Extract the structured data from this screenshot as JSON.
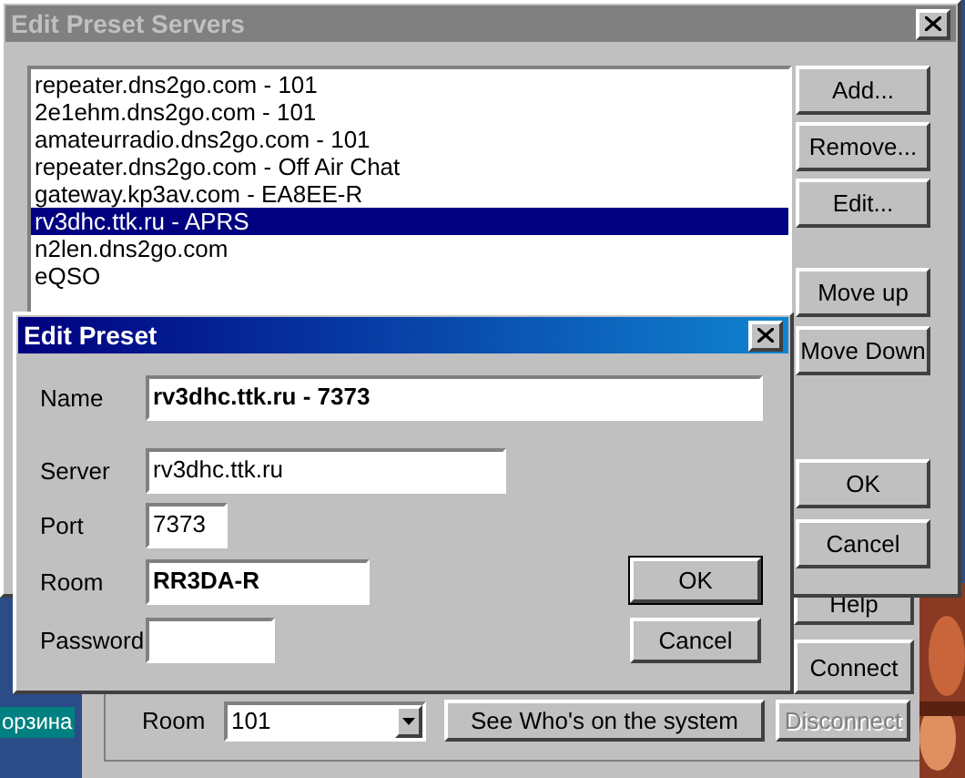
{
  "desktop": {
    "icon_label": "орзина"
  },
  "main_window": {
    "buttons": [
      {
        "label": "Help",
        "disabled": false
      },
      {
        "label": "Connect",
        "disabled": false
      }
    ],
    "room_label": "Room",
    "room_value": "101",
    "who_button": "See Who's on the system",
    "disconnect": {
      "label": "Disconnect",
      "disabled": true
    }
  },
  "servers_dialog": {
    "title": "Edit Preset Servers",
    "active": false,
    "items": [
      {
        "label": "repeater.dns2go.com - 101",
        "selected": false
      },
      {
        "label": "2e1ehm.dns2go.com - 101",
        "selected": false
      },
      {
        "label": "amateurradio.dns2go.com - 101",
        "selected": false
      },
      {
        "label": "repeater.dns2go.com - Off Air Chat",
        "selected": false
      },
      {
        "label": "gateway.kp3av.com - EA8EE-R",
        "selected": false
      },
      {
        "label": "rv3dhc.ttk.ru - APRS",
        "selected": true
      },
      {
        "label": "n2len.dns2go.com",
        "selected": false
      },
      {
        "label": "eQSO",
        "selected": false
      }
    ],
    "buttons": [
      "Add...",
      "Remove...",
      "Edit...",
      "Move up",
      "Move Down",
      "OK",
      "Cancel"
    ]
  },
  "preset_dialog": {
    "title": "Edit Preset",
    "active": true,
    "fields": [
      {
        "label": "Name",
        "value": "rv3dhc.ttk.ru - 7373",
        "bold": true
      },
      {
        "label": "Server",
        "value": "rv3dhc.ttk.ru",
        "bold": false
      },
      {
        "label": "Port",
        "value": "7373",
        "bold": false
      },
      {
        "label": "Room",
        "value": "RR3DA-R",
        "bold": true
      },
      {
        "label": "Password"
      }
    ],
    "buttons": [
      {
        "label": "OK",
        "default": true
      },
      {
        "label": "Cancel",
        "default": false
      }
    ]
  }
}
